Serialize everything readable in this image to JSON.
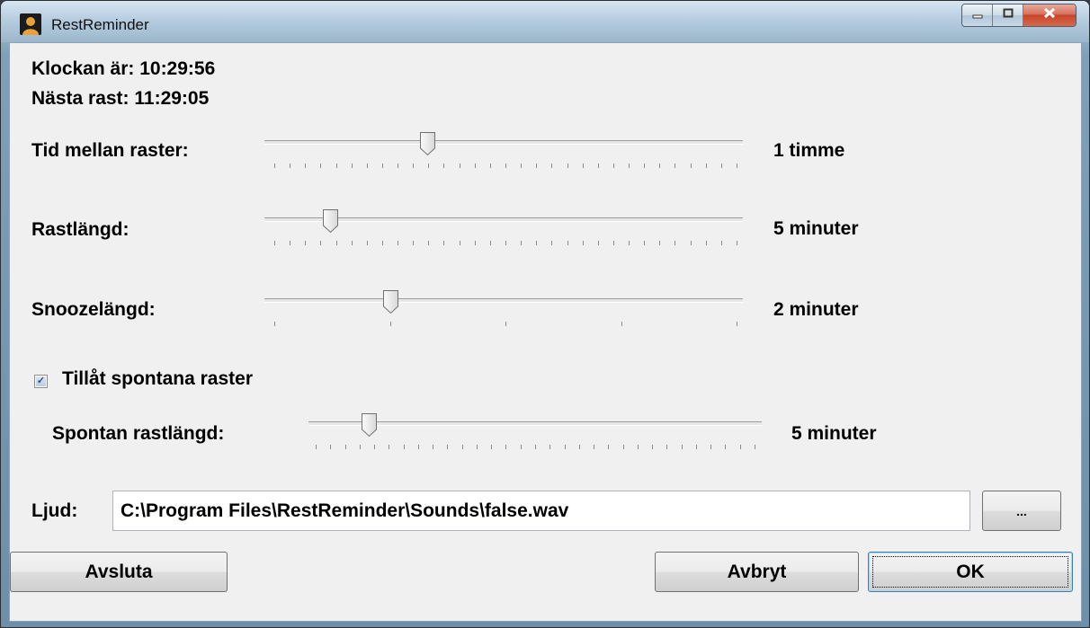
{
  "window": {
    "title": "RestReminder"
  },
  "status": {
    "clock": "Klockan är: 10:29:56",
    "next_break": "Nästa rast: 11:29:05"
  },
  "settings": {
    "interval": {
      "label": "Tid mellan raster:",
      "value": "1 timme",
      "slider_fraction": 0.33,
      "tick_count": 31
    },
    "break_length": {
      "label": "Rastlängd:",
      "value": "5 minuter",
      "slider_fraction": 0.12,
      "tick_count": 31
    },
    "snooze_length": {
      "label": "Snoozelängd:",
      "value": "2 minuter",
      "slider_fraction": 0.25,
      "tick_count": 5
    },
    "spontaneous": {
      "checkbox_label": "Tillåt spontana raster",
      "checked": true,
      "length_label": "Spontan rastlängd:",
      "length_value": "5 minuter",
      "slider_fraction": 0.12,
      "tick_count": 31
    },
    "sound": {
      "label": "Ljud:",
      "path": "C:\\Program Files\\RestReminder\\Sounds\\false.wav",
      "browse_label": "..."
    }
  },
  "buttons": {
    "quit": "Avsluta",
    "cancel": "Avbryt",
    "ok": "OK"
  },
  "colors": {
    "accent": "#3c7fb1",
    "close_button": "#c7452b"
  }
}
